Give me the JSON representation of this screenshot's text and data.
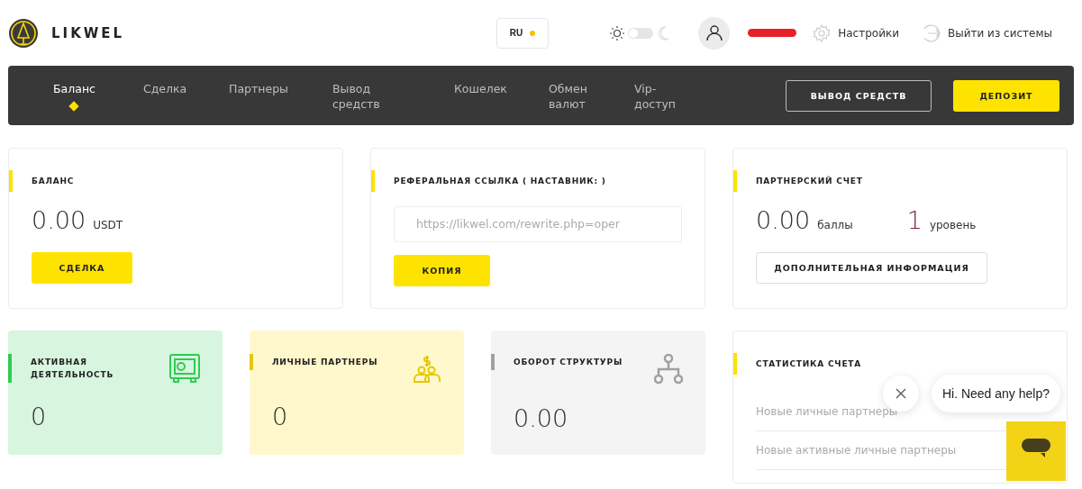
{
  "brand": {
    "name": "LIKWEL"
  },
  "header": {
    "language": "RU",
    "dark_mode": {
      "on": false
    },
    "settings": "Настройки",
    "logout": "Выйти из системы"
  },
  "nav": {
    "tabs": [
      {
        "label": "Баланс",
        "selected": true
      },
      {
        "label": "Сделка",
        "selected": false
      },
      {
        "label": "Партнеры",
        "selected": false
      },
      {
        "label": "Вывод средств",
        "selected": false
      },
      {
        "label": "Кошелек",
        "selected": false
      },
      {
        "label": "Обмен валют",
        "selected": false
      },
      {
        "label": "Vip-доступ",
        "selected": false
      }
    ],
    "withdraw_button": "ВЫВОД СРЕДСТВ",
    "deposit_button": "ДЕПОЗИТ"
  },
  "balance": {
    "title": "БАЛАНС",
    "amount": "0.00",
    "currency": "USDT",
    "button": "СДЕЛКА"
  },
  "referral": {
    "title": "РЕФЕРАЛЬНАЯ ССЫЛКА ( НАСТАВНИК: )",
    "link": "https://likwel.com/rewrite.php=oper",
    "button": "КОПИЯ"
  },
  "partner_account": {
    "title": "ПАРТНЕРСКИЙ СЧЕТ",
    "points": "0.00",
    "points_unit": "баллы",
    "level": "1",
    "level_unit": "уровень",
    "button": "ДОПОЛНИТЕЛЬНАЯ ИНФОРМАЦИЯ"
  },
  "stat_cards": [
    {
      "kind": "safe",
      "title": "АКТИВНАЯ ДЕЯТЕЛЬНОСТЬ",
      "value": "0",
      "color": "#2ecc52"
    },
    {
      "kind": "partners",
      "title": "ЛИЧНЫЕ ПАРТНЕРЫ",
      "value": "0",
      "color": "#e6c800"
    },
    {
      "kind": "structure",
      "title": "ОБОРОТ СТРУКТУРЫ",
      "value": "0.00",
      "color": "#a0a0a0"
    }
  ],
  "account_stats": {
    "title": "СТАТИСТИКА СЧЕТА",
    "rows": [
      "Новые личные партнеры",
      "Новые активные личные партнеры"
    ]
  },
  "chat": {
    "message": "Hi. Need any help?"
  }
}
